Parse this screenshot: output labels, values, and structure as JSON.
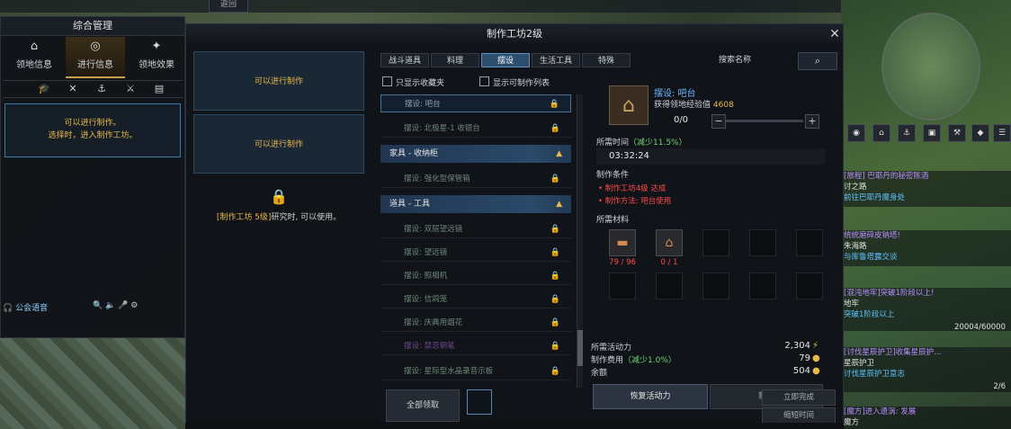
{
  "topbar": {
    "left_button": "返回"
  },
  "left_panel": {
    "title": "综合管理",
    "tabs": [
      {
        "label": "领地信息",
        "icon": "house-icon"
      },
      {
        "label": "进行信息",
        "icon": "compass-icon"
      },
      {
        "label": "领地效果",
        "icon": "sparkle-icon"
      }
    ],
    "message_line1": "可以进行制作。",
    "message_line2": "选择时，进入制作工坊。",
    "guild_voice": "公会语音"
  },
  "craft": {
    "title": "制作工坊2级",
    "slot1": "可以进行制作",
    "slot2": "可以进行制作",
    "lock_prefix": "[制作工坊 5级]",
    "lock_suffix": "研究时, 可以使用。",
    "claim_all": "全部领取",
    "tabs": [
      "战斗道具",
      "料理",
      "摆设",
      "生活工具",
      "特殊"
    ],
    "search_label": "搜索名称",
    "check_favorites": "只显示收藏夹",
    "check_craftable": "显示可制作列表",
    "list": {
      "item_bar": "摆设: 吧台",
      "item_north": "摆设: 北极星-1 收银台",
      "header_furniture": "家具 - 收纳柜",
      "item_cabinet": "摆设: 强化型保管箱",
      "header_tools": "道具 - 工具",
      "tool_1": "摆设: 双层望远镜",
      "tool_2": "摆设: 望远镜",
      "tool_3": "摆设: 照相机",
      "tool_4": "摆设: 信鸽笼",
      "tool_5": "摆设: 庆典用烟花",
      "tool_6": "摆设: 禁忌钢笔",
      "tool_7": "摆设: 星际型水晶录音示板"
    },
    "detail": {
      "item_name": "摆设: 吧台",
      "exp_label": "获得领地经验值",
      "exp_value": "4608",
      "quantity": "0/0",
      "time_label": "所需时间",
      "time_bonus": "（减少11.5%）",
      "time_value": "03:32:24",
      "conditions_label": "制作条件",
      "condition_1": "制作工坊4级 达成",
      "condition_2": "制作方法: 吧台使用",
      "materials_label": "所需材料",
      "material_1_count": "79 / 96",
      "material_2_count": "0 / 1",
      "activity_label": "所需活动力",
      "activity_value": "2,304",
      "cost_label": "制作费用",
      "cost_bonus": "（减少1.0%）",
      "cost_value": "79",
      "balance_label": "余额",
      "balance_value": "504",
      "restore_btn": "恢复活动力",
      "craft_btn": "制作"
    },
    "instant_btn": "立即完成",
    "shorten_btn": "缩短时间"
  },
  "hud": {
    "quests": [
      {
        "title": "[旅程] 巴耶丹的秘密陈酒",
        "sub": "讨之路",
        "hint": "前往巴耶丹魔身处"
      },
      {
        "title": "统统磨碎皮钠塔!",
        "sub": "朱海路",
        "hint": "与库鲁塔露交谈"
      },
      {
        "title": "[混沌地牢]突破1阶段以上!",
        "sub": "地牢",
        "hint": "突破1阶段以上",
        "progress": "20004/60000"
      },
      {
        "title": "[讨伐星辰护卫]收集星辰护...",
        "sub": "星辰护卫",
        "hint": "讨伐星辰护卫意志",
        "progress": "2/6"
      },
      {
        "title": "[魔方]进入遗涡: 发展",
        "sub": "魔方",
        "hint": ""
      }
    ]
  }
}
